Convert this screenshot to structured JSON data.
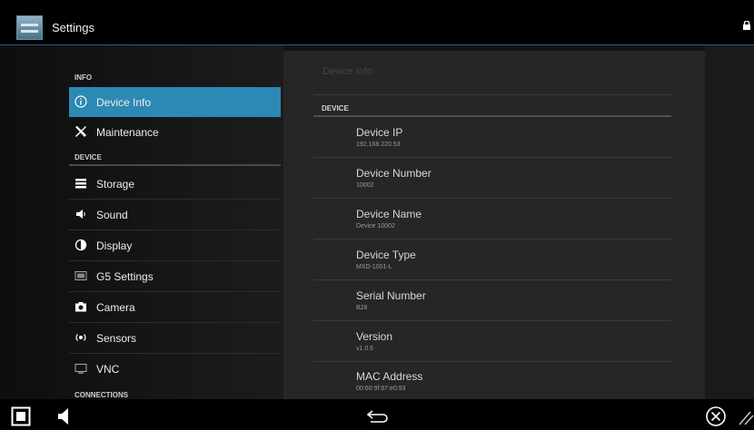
{
  "titlebar": {
    "title": "Settings"
  },
  "sidebar": {
    "sections": [
      {
        "header": "INFO",
        "items": [
          {
            "label": "Device Info",
            "icon": "info-icon",
            "selected": true
          },
          {
            "label": "Maintenance",
            "icon": "tools-icon"
          }
        ]
      },
      {
        "header": "DEVICE",
        "items": [
          {
            "label": "Storage",
            "icon": "storage-icon"
          },
          {
            "label": "Sound",
            "icon": "speaker-icon"
          },
          {
            "label": "Display",
            "icon": "display-icon"
          },
          {
            "label": "G5 Settings",
            "icon": "g5-icon"
          },
          {
            "label": "Camera",
            "icon": "camera-icon"
          },
          {
            "label": "Sensors",
            "icon": "sensors-icon"
          },
          {
            "label": "VNC",
            "icon": "vnc-icon"
          }
        ]
      },
      {
        "header": "CONNECTIONS",
        "items": []
      }
    ]
  },
  "detail": {
    "title": "Device Info",
    "section_header": "DEVICE",
    "items": [
      {
        "name": "Device IP",
        "value": "192.168.220.53"
      },
      {
        "name": "Device Number",
        "value": "10002"
      },
      {
        "name": "Device Name",
        "value": "Device 10002"
      },
      {
        "name": "Device Type",
        "value": "MXD-1001-L"
      },
      {
        "name": "Serial Number",
        "value": "B28"
      },
      {
        "name": "Version",
        "value": "v1.0.6"
      },
      {
        "name": "MAC Address",
        "value": "00:60:9f:97:e0:93"
      }
    ]
  },
  "colors": {
    "accent": "#2c89b4",
    "background": "#000000",
    "panel": "#262626"
  }
}
